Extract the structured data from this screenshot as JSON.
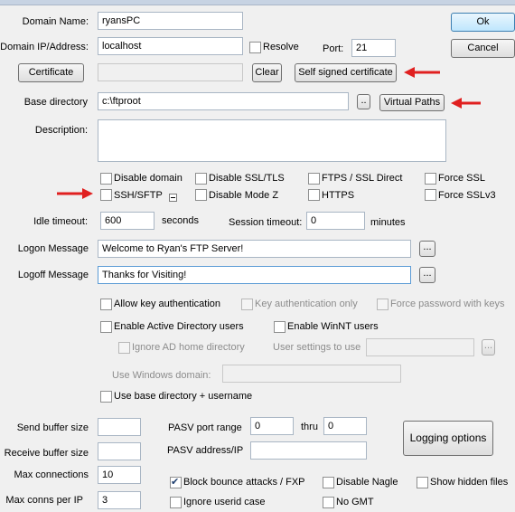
{
  "domain": {
    "name_label": "Domain Name:",
    "name_value": "ryansPC",
    "ip_label": "Domain IP/Address:",
    "ip_value": "localhost",
    "resolve_label": "Resolve",
    "port_label": "Port:",
    "port_value": "21"
  },
  "buttons": {
    "ok": "Ok",
    "cancel": "Cancel",
    "certificate": "Certificate",
    "clear": "Clear",
    "self_signed": "Self signed certificate",
    "browse": "..",
    "virtual_paths": "Virtual Paths",
    "logon_browse": "...",
    "logoff_browse": "...",
    "user_settings_browse": "...",
    "logging_options": "Logging options"
  },
  "base_directory": {
    "label": "Base directory",
    "value": "c:\\ftproot"
  },
  "description": {
    "label": "Description:",
    "value": ""
  },
  "options": {
    "disable_domain": "Disable domain",
    "disable_ssl_tls": "Disable SSL/TLS",
    "ftps_ssl_direct": "FTPS / SSL Direct",
    "force_ssl": "Force SSL",
    "ssh_sftp": "SSH/SFTP",
    "disable_mode_z": "Disable Mode Z",
    "https": "HTTPS",
    "force_sslv3": "Force SSLv3"
  },
  "timeouts": {
    "idle_label": "Idle timeout:",
    "idle_value": "600",
    "idle_unit": "seconds",
    "session_label": "Session timeout:",
    "session_value": "0",
    "session_unit": "minutes"
  },
  "messages": {
    "logon_label": "Logon Message",
    "logon_value": "Welcome to Ryan's FTP Server!",
    "logoff_label": "Logoff Message",
    "logoff_value": "Thanks for Visiting!"
  },
  "auth": {
    "allow_key": "Allow key authentication",
    "key_only": "Key authentication only",
    "force_password": "Force password with keys",
    "enable_ad": "Enable Active Directory users",
    "enable_winnt": "Enable WinNT users",
    "ignore_ad_home": "Ignore AD home directory",
    "user_settings_label": "User settings to use",
    "windows_domain_label": "Use Windows domain:",
    "use_base_dir": "Use base directory + username"
  },
  "network": {
    "send_buffer_label": "Send buffer size",
    "receive_buffer_label": "Receive buffer size",
    "max_conn_label": "Max connections",
    "max_conn_value": "10",
    "max_per_ip_label": "Max conns per IP",
    "max_per_ip_value": "3",
    "pasv_range_label": "PASV port range",
    "pasv_from": "0",
    "pasv_thru_label": "thru",
    "pasv_to": "0",
    "pasv_address_label": "PASV address/IP",
    "block_bounce": "Block bounce attacks / FXP",
    "disable_nagle": "Disable Nagle",
    "show_hidden": "Show hidden files",
    "ignore_userid_case": "Ignore userid case",
    "no_gmt": "No GMT"
  },
  "colors": {
    "arrow": "#e02020",
    "input_border": "#a9b6c4",
    "default_button": "#3c7fb1"
  }
}
